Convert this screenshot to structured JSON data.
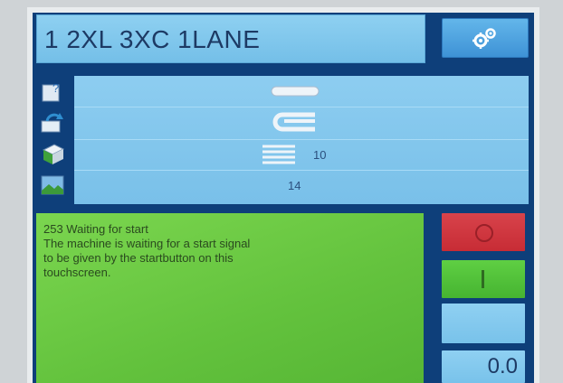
{
  "header": {
    "title": "1 2XL 3XC 1LANE",
    "settings_icon": "gears-icon"
  },
  "info": {
    "count_a": "10",
    "count_b": "14"
  },
  "sidebar_icons": [
    "help-book-icon",
    "refresh-icon",
    "stack-icon",
    "landscape-icon"
  ],
  "message": {
    "line1": "253 Waiting for start",
    "line2": "The machine is waiting for a start signal",
    "line3": "to be given by the startbutton on this",
    "line4": "touchscreen."
  },
  "controls": {
    "stop_color": "#d03a42",
    "start_color": "#52c23a",
    "speed_value": "0.0"
  }
}
